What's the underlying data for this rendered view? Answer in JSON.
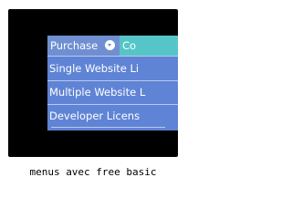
{
  "menu": {
    "top_items": [
      {
        "label": "Purchase"
      },
      {
        "label": "Co"
      }
    ],
    "dropdown_items": [
      {
        "label": "Single Website Li"
      },
      {
        "label": "Multiple Website L"
      },
      {
        "label": "Developer Licens"
      }
    ],
    "arrow_icon": "chevron-down-icon",
    "colors": {
      "frame": "#000000",
      "menu_item": "#6f8fd2",
      "menu_item_alt": "#56c5c7",
      "dropdown_bg": "#5f84d6",
      "separator": "#b9c9ee"
    }
  },
  "caption": "menus avec free basic"
}
